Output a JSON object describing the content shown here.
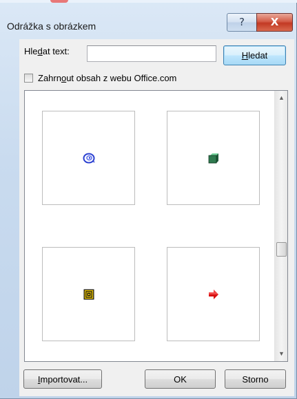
{
  "dialog": {
    "title": "Odrážka s obrázkem",
    "help_glyph": "?",
    "close_glyph": "X"
  },
  "search": {
    "label_pre": "Hle",
    "label_key": "d",
    "label_post": "at text:",
    "value": "",
    "placeholder": "",
    "button_key": "H",
    "button_rest": "ledat"
  },
  "include_web": {
    "checked": false,
    "label_pre": "Zahrn",
    "label_key": "o",
    "label_post": "ut obsah z webu Office.com"
  },
  "grid": {
    "tiles": [
      {
        "icon": "spiral-bullet-icon",
        "color": "#2a3fd0"
      },
      {
        "icon": "green-cube-bullet-icon",
        "color": "#2f7a4f"
      },
      {
        "icon": "square-spiral-bullet-icon",
        "color": "#c8a400"
      },
      {
        "icon": "red-arrow-bullet-icon",
        "color": "#d81010"
      }
    ]
  },
  "footer": {
    "import_key": "I",
    "import_rest": "mportovat...",
    "ok_label": "OK",
    "cancel_label": "Storno"
  }
}
